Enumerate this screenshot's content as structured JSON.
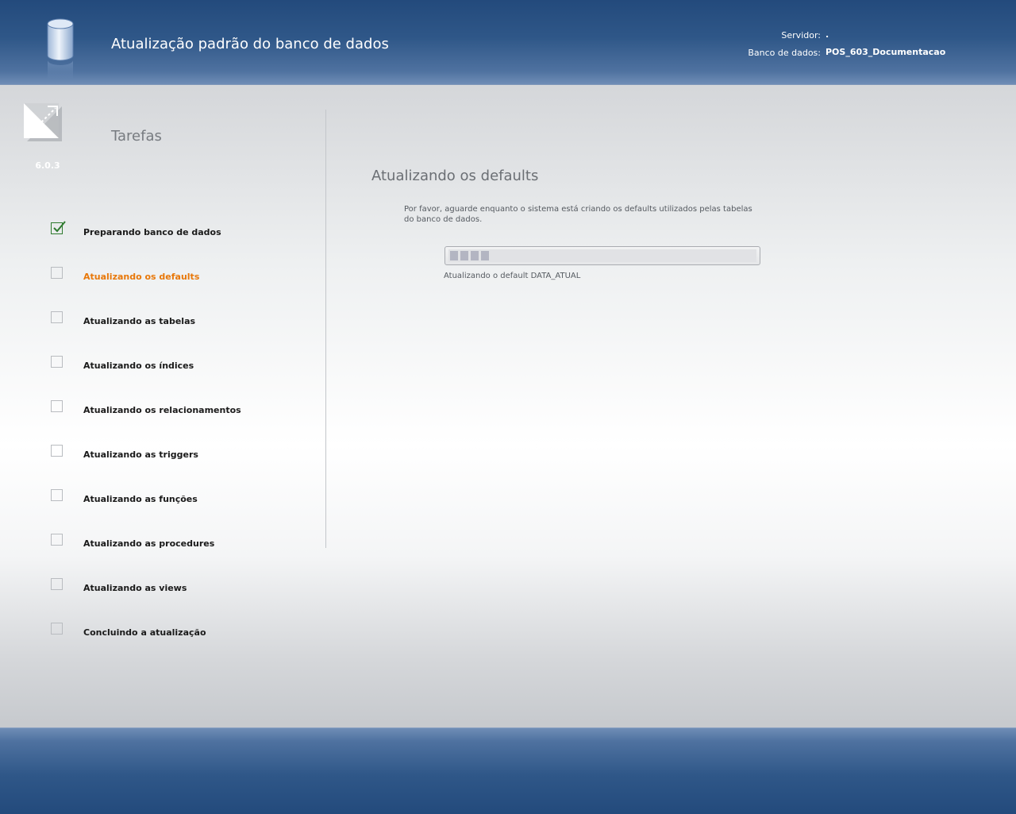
{
  "header": {
    "title": "Atualização padrão do banco de dados",
    "server_label": "Servidor:",
    "server_value": ".",
    "database_label": "Banco de dados:",
    "database_value": "POS_603_Documentacao",
    "icon": "database-icon"
  },
  "sidebar": {
    "logo_icon": "expand-arrow-logo-icon",
    "version": "6.0.3",
    "title": "Tarefas",
    "tasks": [
      {
        "label": "Preparando banco de dados",
        "status": "done"
      },
      {
        "label": "Atualizando os defaults",
        "status": "active"
      },
      {
        "label": "Atualizando as tabelas",
        "status": "pending"
      },
      {
        "label": "Atualizando os índices",
        "status": "pending"
      },
      {
        "label": "Atualizando os relacionamentos",
        "status": "pending"
      },
      {
        "label": "Atualizando as triggers",
        "status": "pending"
      },
      {
        "label": "Atualizando as funções",
        "status": "pending"
      },
      {
        "label": "Atualizando as procedures",
        "status": "pending"
      },
      {
        "label": "Atualizando as views",
        "status": "pending"
      },
      {
        "label": "Concluindo a atualização",
        "status": "pending"
      }
    ]
  },
  "main": {
    "title": "Atualizando os defaults",
    "description": "Por favor, aguarde enquanto o sistema está criando os defaults utilizados pelas tabelas do banco de dados.",
    "progress": {
      "fraction": 0.13,
      "status": "Atualizando o default DATA_ATUAL"
    }
  },
  "colors": {
    "header_bg": "#2f5788",
    "active_task": "#e8780a",
    "done_check": "#2f7a2f",
    "progress_fill": "#b3b5c2"
  }
}
